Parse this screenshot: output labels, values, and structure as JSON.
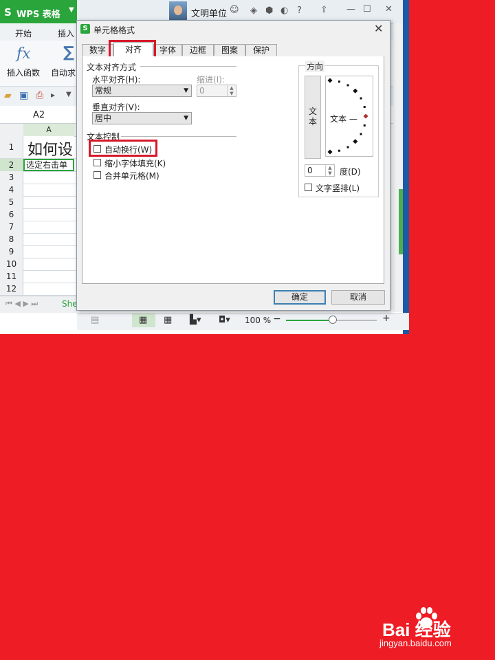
{
  "app": {
    "logo": "S",
    "name": "WPS 表格"
  },
  "titlebar": {
    "doc_name": "文明单位"
  },
  "ribbon": {
    "tabs": [
      "开始",
      "插入"
    ],
    "insert_function_label": "插入函数",
    "autosum_label": "自动求",
    "fx_glyph": "fx",
    "sum_glyph": "∑"
  },
  "formula_bar": {
    "cell_ref": "A2"
  },
  "grid": {
    "column_a": "A",
    "rows": [
      "1",
      "2",
      "3",
      "4",
      "5",
      "6",
      "7",
      "8",
      "9",
      "10",
      "11",
      "12"
    ],
    "cell_a1": "如何设",
    "cell_a2": "选定右击单"
  },
  "sheet_tab": "She",
  "statusbar": {
    "zoom": "100 %",
    "minus": "−",
    "plus": "+"
  },
  "dialog": {
    "title": "单元格格式",
    "tabs": [
      "数字",
      "对齐",
      "字体",
      "边框",
      "图案",
      "保护"
    ],
    "active_tab": "对齐",
    "text_align": {
      "group_title": "文本对齐方式",
      "horizontal_label": "水平对齐(H):",
      "horizontal_value": "常规",
      "indent_label": "缩进(I):",
      "indent_value": "0",
      "vertical_label": "垂直对齐(V):",
      "vertical_value": "居中"
    },
    "text_control": {
      "group_title": "文本控制",
      "wrap": {
        "label": "自动换行(W)",
        "checked": false
      },
      "shrink": {
        "label": "缩小字体填充(K)",
        "checked": false
      },
      "merge": {
        "label": "合并单元格(M)",
        "checked": false
      }
    },
    "orientation": {
      "group_title": "方向",
      "vertical_text": "文本",
      "horizontal_text": "文本 —",
      "degrees_value": "0",
      "degrees_label": "度(D)",
      "vertical_layout_label": "文字竖排(L)"
    },
    "buttons": {
      "ok": "确定",
      "cancel": "取消"
    }
  },
  "highlight_color": "#d6182a",
  "background_color": "#ee1c24",
  "watermark": {
    "brand": "Bai 经验",
    "url": "jingyan.baidu.com"
  }
}
